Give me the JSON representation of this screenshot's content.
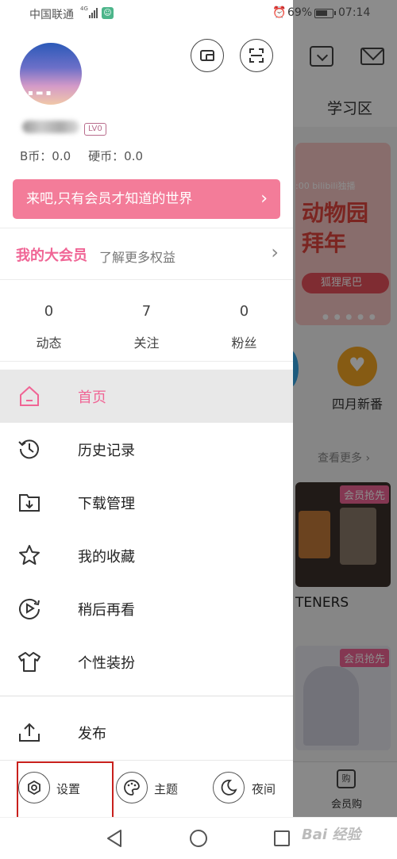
{
  "status_bar": {
    "carrier": "中国联通",
    "network": "4G",
    "battery": "69%",
    "time": "07:14"
  },
  "background": {
    "tab": "学习区",
    "banner_logo": ":00 bilibili独播",
    "banner_title": "动物园\n拜年",
    "banner_tag": "狐狸尾巴",
    "shortcut_label": "四月新番",
    "see_more": "查看更多",
    "badge": "会员抢先",
    "card_title": "TENERS",
    "shop_label": "会员购"
  },
  "drawer": {
    "level": "LV0",
    "bcoin": "B币：0.0",
    "coin": "硬币：0.0",
    "vip_banner": "来吧,只有会员才知道的世界",
    "big_member_title": "我的大会员",
    "big_member_sub": "了解更多权益",
    "stats": [
      {
        "num": "0",
        "label": "动态"
      },
      {
        "num": "7",
        "label": "关注"
      },
      {
        "num": "0",
        "label": "粉丝"
      }
    ],
    "menu": [
      {
        "label": "首页",
        "icon": "home-icon"
      },
      {
        "label": "历史记录",
        "icon": "history-icon"
      },
      {
        "label": "下载管理",
        "icon": "download-folder-icon"
      },
      {
        "label": "我的收藏",
        "icon": "star-icon"
      },
      {
        "label": "稍后再看",
        "icon": "watch-later-icon"
      },
      {
        "label": "个性装扮",
        "icon": "tshirt-icon"
      }
    ],
    "publish": "发布",
    "bottom": [
      {
        "label": "设置",
        "icon": "settings-icon"
      },
      {
        "label": "主题",
        "icon": "palette-icon"
      },
      {
        "label": "夜间",
        "icon": "moon-icon"
      }
    ]
  },
  "watermark": "Bai 经验",
  "colors": {
    "accent": "#f06595",
    "banner": "#f37c99",
    "highlight": "#c8201c"
  }
}
